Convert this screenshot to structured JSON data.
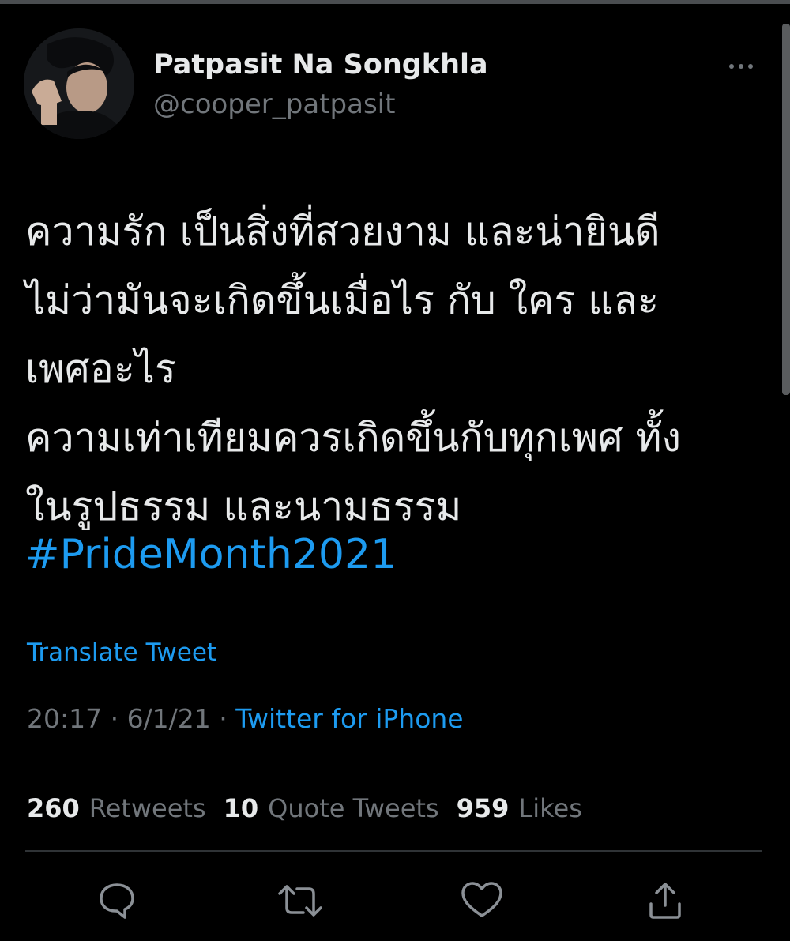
{
  "tweet": {
    "author": {
      "display_name": "Patpasit Na Songkhla",
      "handle": "@cooper_patpasit"
    },
    "text_lines": [
      "ความรัก เป็นสิ่งที่สวยงาม และน่ายินดี",
      "ไม่ว่ามันจะเกิดขึ้นเมื่อไร กับ ใคร และ",
      "เพศอะไร",
      "ความเท่าเทียมควรเกิดขึ้นกับทุกเพศ ทั้ง",
      "ในรูปธรรม และนามธรรม"
    ],
    "hashtag": "#PrideMonth2021",
    "translate_label": "Translate Tweet",
    "timestamp": "20:17 · 6/1/21 · ",
    "source": "Twitter for iPhone",
    "stats": {
      "retweets_count": "260",
      "retweets_label": "Retweets",
      "quotes_count": "10",
      "quotes_label": "Quote Tweets",
      "likes_count": "959",
      "likes_label": "Likes"
    }
  },
  "icons": {
    "more": "more-horizontal-icon",
    "reply": "reply-icon",
    "retweet": "retweet-icon",
    "like": "heart-icon",
    "share": "share-icon"
  },
  "colors": {
    "background": "#000000",
    "text_primary": "#e7e9ea",
    "text_secondary": "#71767b",
    "accent": "#1d9bf0",
    "divider": "#2f3336"
  }
}
